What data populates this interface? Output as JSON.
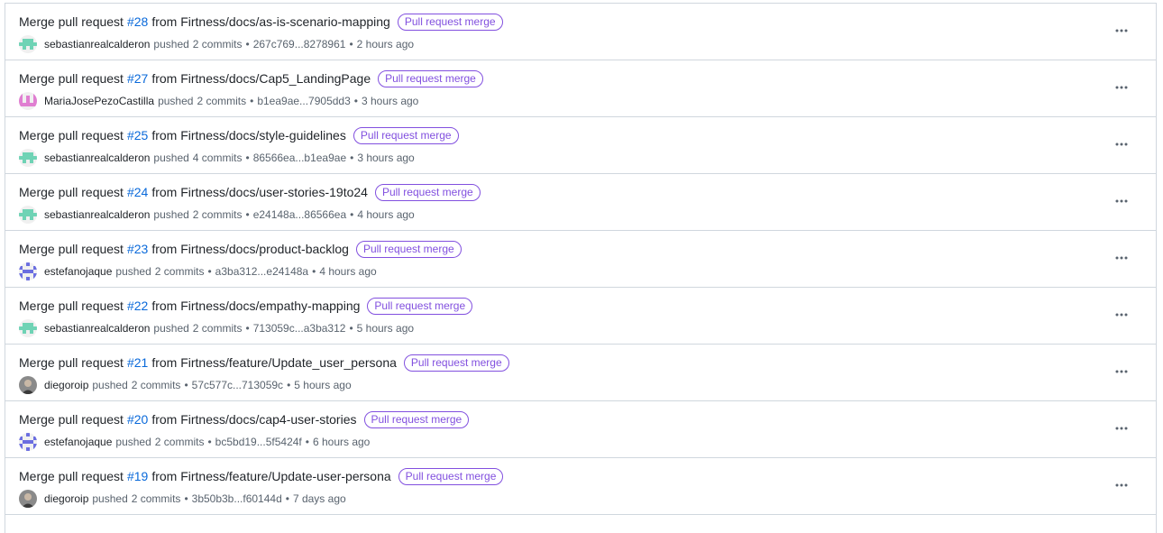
{
  "activities": [
    {
      "title_prefix": "Merge pull request",
      "pr_number": "#28",
      "title_suffix": "from Firtness/docs/as-is-scenario-mapping",
      "badge": "Pull request merge",
      "author": "sebastianrealcalderon",
      "action": "pushed",
      "commits": "2 commits",
      "range": "267c769...8278961",
      "time": "2 hours ago",
      "avatar": "identicon-green"
    },
    {
      "title_prefix": "Merge pull request",
      "pr_number": "#27",
      "title_suffix": "from Firtness/docs/Cap5_LandingPage",
      "badge": "Pull request merge",
      "author": "MariaJosePezoCastilla",
      "action": "pushed",
      "commits": "2 commits",
      "range": "b1ea9ae...7905dd3",
      "time": "3 hours ago",
      "avatar": "identicon-pink"
    },
    {
      "title_prefix": "Merge pull request",
      "pr_number": "#25",
      "title_suffix": "from Firtness/docs/style-guidelines",
      "badge": "Pull request merge",
      "author": "sebastianrealcalderon",
      "action": "pushed",
      "commits": "4 commits",
      "range": "86566ea...b1ea9ae",
      "time": "3 hours ago",
      "avatar": "identicon-green"
    },
    {
      "title_prefix": "Merge pull request",
      "pr_number": "#24",
      "title_suffix": "from Firtness/docs/user-stories-19to24",
      "badge": "Pull request merge",
      "author": "sebastianrealcalderon",
      "action": "pushed",
      "commits": "2 commits",
      "range": "e24148a...86566ea",
      "time": "4 hours ago",
      "avatar": "identicon-green"
    },
    {
      "title_prefix": "Merge pull request",
      "pr_number": "#23",
      "title_suffix": "from Firtness/docs/product-backlog",
      "badge": "Pull request merge",
      "author": "estefanojaque",
      "action": "pushed",
      "commits": "2 commits",
      "range": "a3ba312...e24148a",
      "time": "4 hours ago",
      "avatar": "identicon-blue"
    },
    {
      "title_prefix": "Merge pull request",
      "pr_number": "#22",
      "title_suffix": "from Firtness/docs/empathy-mapping",
      "badge": "Pull request merge",
      "author": "sebastianrealcalderon",
      "action": "pushed",
      "commits": "2 commits",
      "range": "713059c...a3ba312",
      "time": "5 hours ago",
      "avatar": "identicon-green"
    },
    {
      "title_prefix": "Merge pull request",
      "pr_number": "#21",
      "title_suffix": "from Firtness/feature/Update_user_persona",
      "badge": "Pull request merge",
      "author": "diegoroip",
      "action": "pushed",
      "commits": "2 commits",
      "range": "57c577c...713059c",
      "time": "5 hours ago",
      "avatar": "photo"
    },
    {
      "title_prefix": "Merge pull request",
      "pr_number": "#20",
      "title_suffix": "from Firtness/docs/cap4-user-stories",
      "badge": "Pull request merge",
      "author": "estefanojaque",
      "action": "pushed",
      "commits": "2 commits",
      "range": "bc5bd19...5f5424f",
      "time": "6 hours ago",
      "avatar": "identicon-blue"
    },
    {
      "title_prefix": "Merge pull request",
      "pr_number": "#19",
      "title_suffix": "from Firtness/feature/Update-user-persona",
      "badge": "Pull request merge",
      "author": "diegoroip",
      "action": "pushed",
      "commits": "2 commits",
      "range": "3b50b3b...f60144d",
      "time": "7 days ago",
      "avatar": "photo"
    }
  ],
  "separator": "•",
  "kebab_icon": "kebab-horizontal-icon",
  "colors": {
    "link": "#0969da",
    "badge": "#8250df",
    "muted": "#59636e",
    "border": "#d0d7de"
  }
}
